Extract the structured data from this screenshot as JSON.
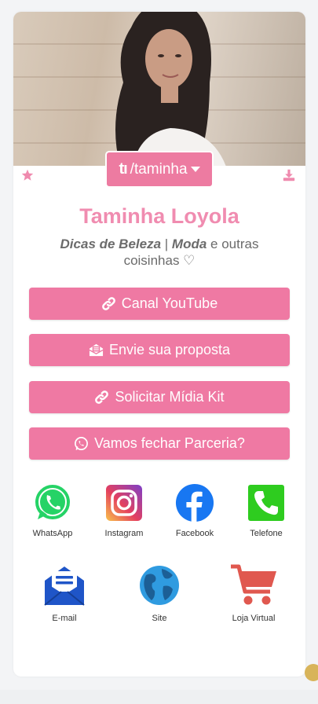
{
  "profile": {
    "handle": "/taminha",
    "name": "Taminha Loyola",
    "bio_part1": "Dicas de Beleza",
    "bio_sep": " | ",
    "bio_part2": "Moda",
    "bio_rest": " e outras coisinhas ♡"
  },
  "buttons": [
    {
      "label": "Canal YouTube",
      "icon": "link-icon"
    },
    {
      "label": "Envie sua proposta",
      "icon": "envelope-open-icon"
    },
    {
      "label": "Solicitar Mídia Kit",
      "icon": "link-icon"
    },
    {
      "label": "Vamos fechar Parceria?",
      "icon": "whatsapp-icon"
    }
  ],
  "social": [
    {
      "label": "WhatsApp",
      "icon": "whatsapp-icon"
    },
    {
      "label": "Instagram",
      "icon": "instagram-icon"
    },
    {
      "label": "Facebook",
      "icon": "facebook-icon"
    },
    {
      "label": "Telefone",
      "icon": "phone-icon"
    },
    {
      "label": "E-mail",
      "icon": "email-icon"
    },
    {
      "label": "Site",
      "icon": "globe-icon"
    },
    {
      "label": "Loja Virtual",
      "icon": "cart-icon"
    }
  ],
  "colors": {
    "accent": "#ef79a3",
    "name": "#f08cb0",
    "whatsapp": "#25d366",
    "facebook": "#1877f2",
    "phone": "#2ecc1f",
    "email": "#1f55c8",
    "globe": "#2f9be0",
    "cart": "#e0584f"
  }
}
